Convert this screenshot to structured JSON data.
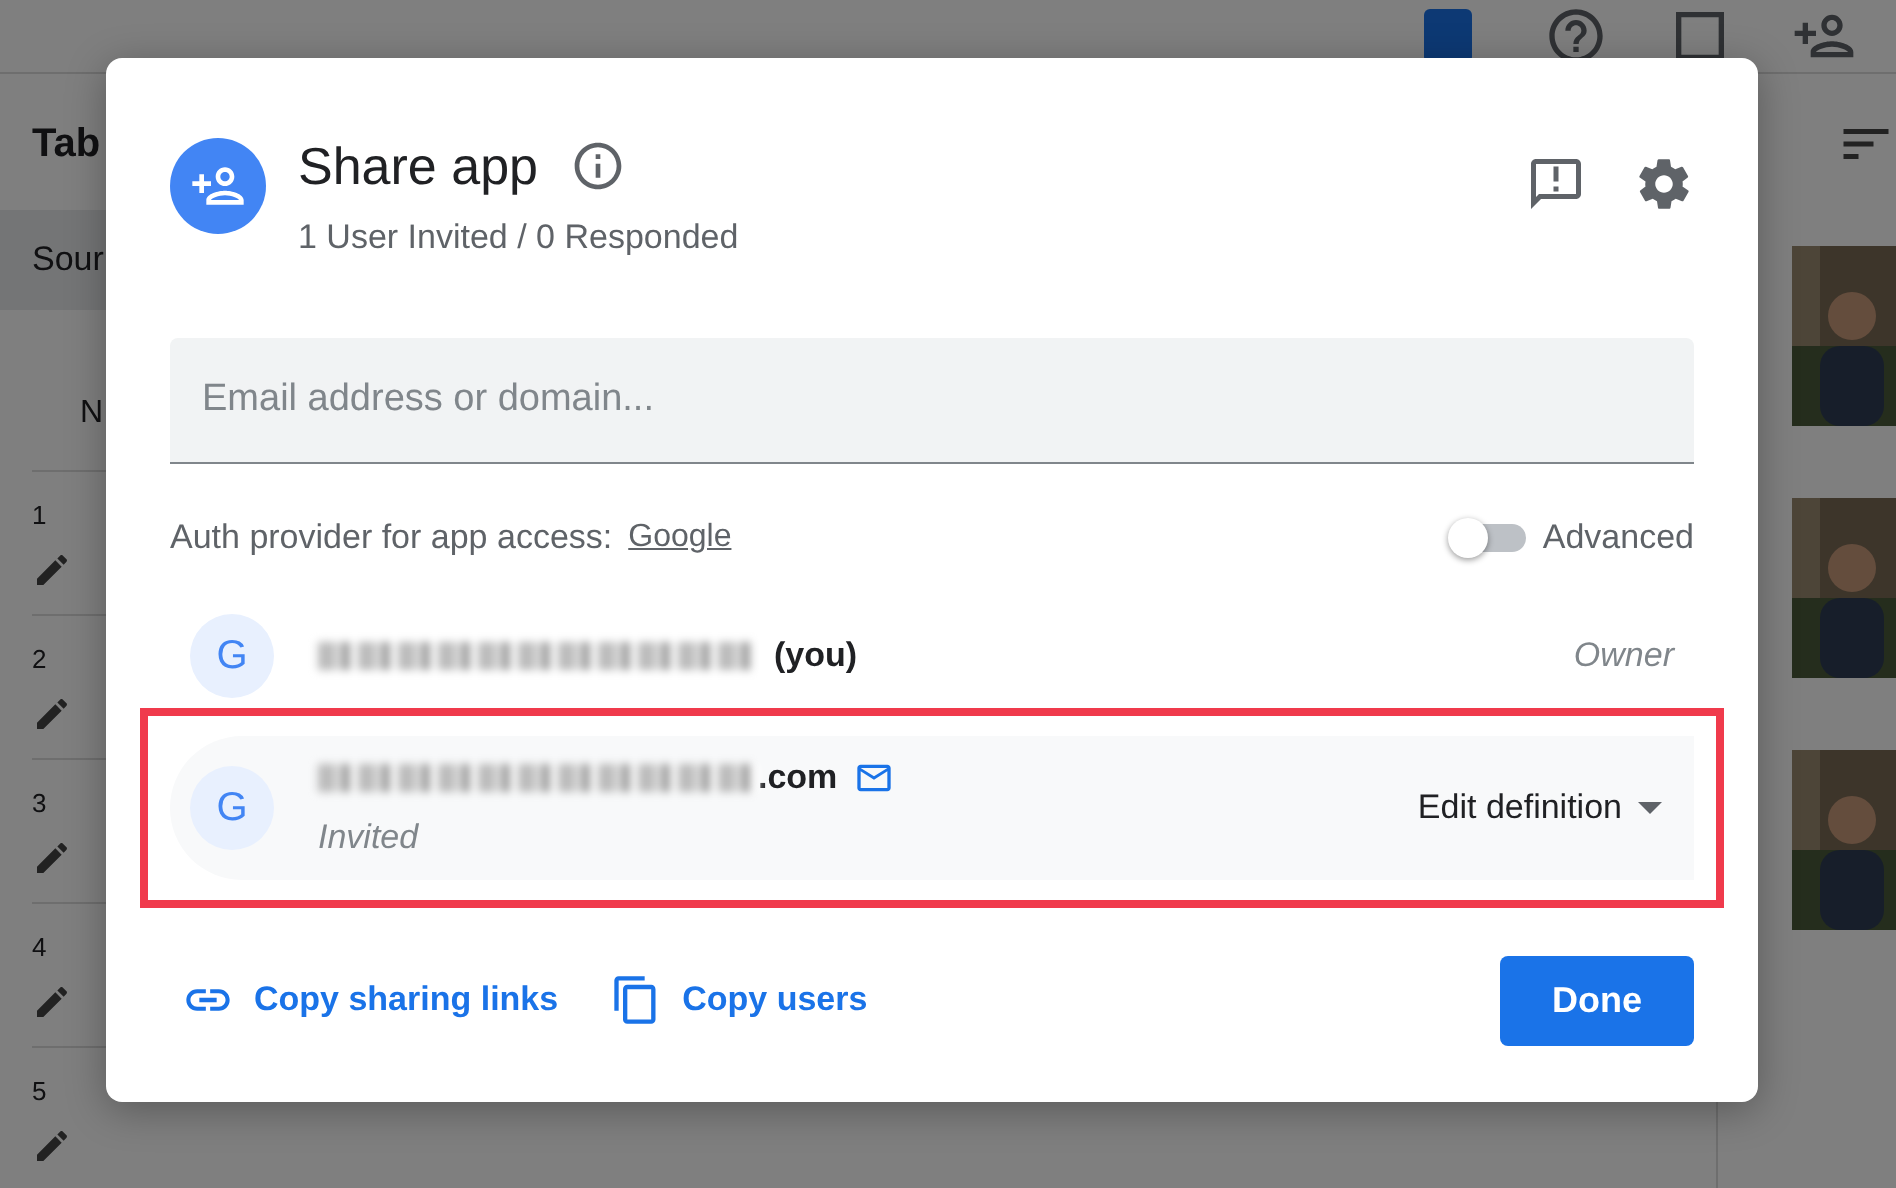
{
  "background": {
    "heading": "Tab",
    "chip": "Sour",
    "column_header": "N",
    "row_numbers": [
      "1",
      "2",
      "3",
      "4",
      "5"
    ]
  },
  "dialog": {
    "title": "Share app",
    "subtitle": "1 User Invited / 0 Responded",
    "email_field": {
      "placeholder": "Email address or domain..."
    },
    "auth": {
      "label": "Auth provider for app access:",
      "provider": "Google"
    },
    "advanced": {
      "label": "Advanced",
      "on": false
    },
    "users": [
      {
        "kind": "owner",
        "name_suffix": "(you)",
        "avatar": "G",
        "role": "Owner",
        "highlighted": false
      },
      {
        "kind": "invited",
        "name_suffix": ".com",
        "avatar": "G",
        "status": "Invited",
        "role": "Edit definition",
        "highlighted": true
      }
    ],
    "actions": [
      {
        "label": "Copy sharing links",
        "kind": "link"
      },
      {
        "label": "Copy users",
        "kind": "copy"
      }
    ],
    "done": "Done"
  }
}
